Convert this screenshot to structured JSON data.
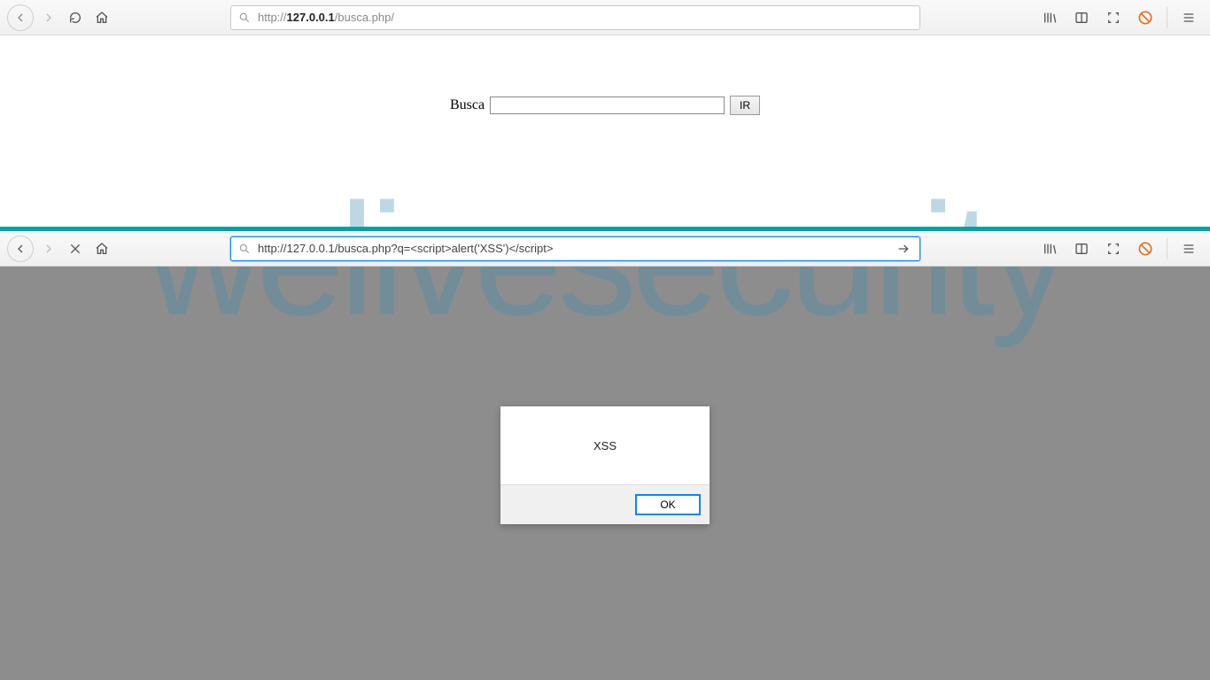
{
  "watermark": "welivesecurity",
  "browser_top": {
    "url_prefix": "http://",
    "url_host": "127.0.0.1",
    "url_path": "/busca.php/"
  },
  "browser_bottom": {
    "url_full": "http://127.0.0.1/busca.php?q=<script>alert('XSS')</script>"
  },
  "page_top": {
    "search_label": "Busca",
    "search_value": "",
    "submit_label": "IR"
  },
  "alert": {
    "message": "XSS",
    "ok_label": "OK"
  }
}
